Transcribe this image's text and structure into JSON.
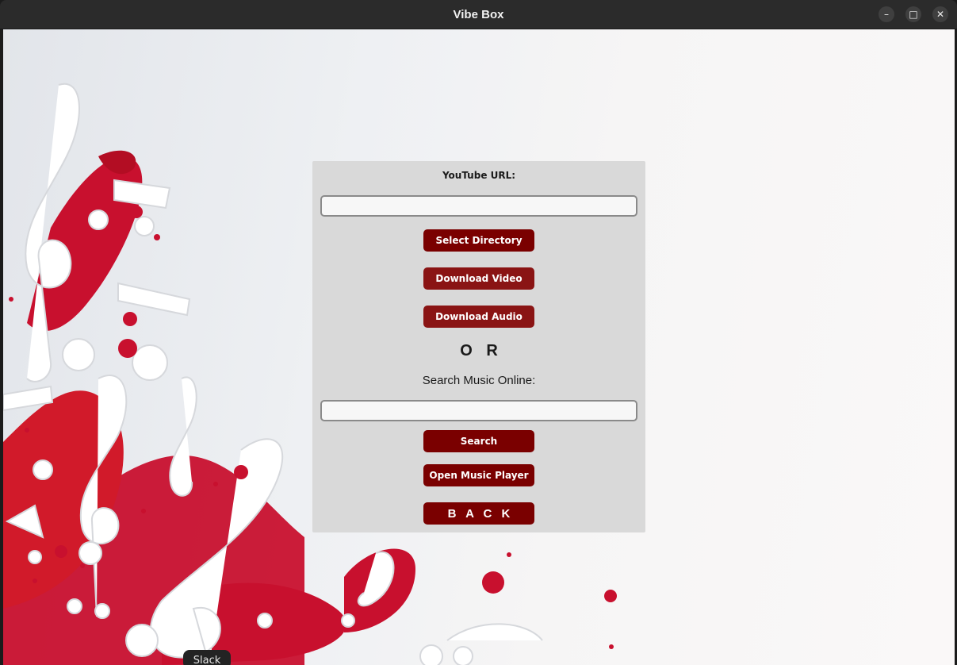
{
  "window": {
    "title": "Vibe Box",
    "controls": {
      "minimize_icon": "minimize-icon",
      "maximize_icon": "maximize-icon",
      "close_icon": "close-icon",
      "minimize_glyph": "–",
      "maximize_glyph": "□",
      "close_glyph": "✕"
    }
  },
  "colors": {
    "button_dark": "#7a0000",
    "button_mid": "#8a1414",
    "panel_bg": "#d9d9d9",
    "accent_red": "#c8102e"
  },
  "panel": {
    "url_label": "YouTube URL:",
    "url_input": {
      "value": "",
      "placeholder": ""
    },
    "select_directory_label": "Select Directory",
    "download_video_label": "Download Video",
    "download_audio_label": "Download Audio",
    "or_label": "O R",
    "search_label": "Search Music Online:",
    "search_input": {
      "value": "",
      "placeholder": ""
    },
    "search_button_label": "Search",
    "open_player_label": "Open Music Player",
    "back_label": "B A C K"
  },
  "taskbar": {
    "tooltip": "Slack"
  }
}
